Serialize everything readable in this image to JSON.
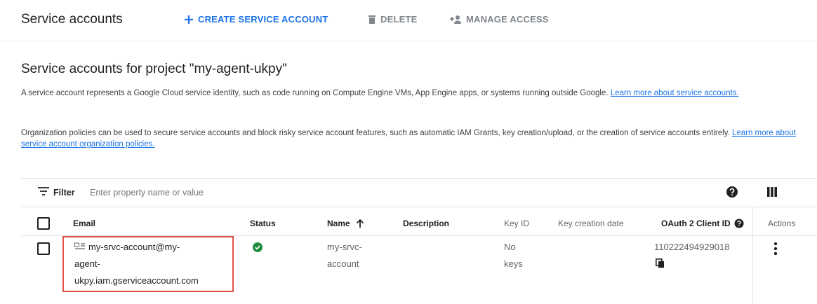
{
  "toolbar": {
    "title": "Service accounts",
    "create_label": "CREATE SERVICE ACCOUNT",
    "delete_label": "DELETE",
    "manage_access_label": "MANAGE ACCESS"
  },
  "main": {
    "heading": "Service accounts for project \"my-agent-ukpy\"",
    "para1_text": "A service account represents a Google Cloud service identity, such as code running on Compute Engine VMs, App Engine apps, or systems running outside Google.",
    "para1_link": "Learn more about service accounts.",
    "para2_text": "Organization policies can be used to secure service accounts and block risky service account features, such as automatic IAM Grants, key creation/upload, or the creation of service accounts entirely.",
    "para2_link": "Learn more about service account organization policies."
  },
  "filter": {
    "label": "Filter",
    "placeholder": "Enter property name or value"
  },
  "table": {
    "headers": {
      "email": "Email",
      "status": "Status",
      "name": "Name",
      "description": "Description",
      "key_id": "Key ID",
      "key_creation_date": "Key creation date",
      "oauth_client_id": "OAuth 2 Client ID",
      "actions": "Actions"
    },
    "rows": [
      {
        "email_line1": "my-srvc-account@my-",
        "email_line2": "agent-",
        "email_line3": "ukpy.iam.gserviceaccount.com",
        "status": "enabled",
        "name_line1": "my-srvc-",
        "name_line2": "account",
        "description": "",
        "key_id_line1": "No",
        "key_id_line2": "keys",
        "oauth_client_id": "110222494929018"
      }
    ]
  },
  "colors": {
    "accent": "#1a73e8",
    "status_ok": "#1e8e3e",
    "highlight": "#e2504a"
  },
  "icons": [
    "plus-icon",
    "trash-icon",
    "person-add-icon",
    "filter-icon",
    "help-icon",
    "columns-icon",
    "sort-arrow-up-icon",
    "service-account-icon",
    "check-circle-icon",
    "copy-icon",
    "more-vert-icon"
  ]
}
